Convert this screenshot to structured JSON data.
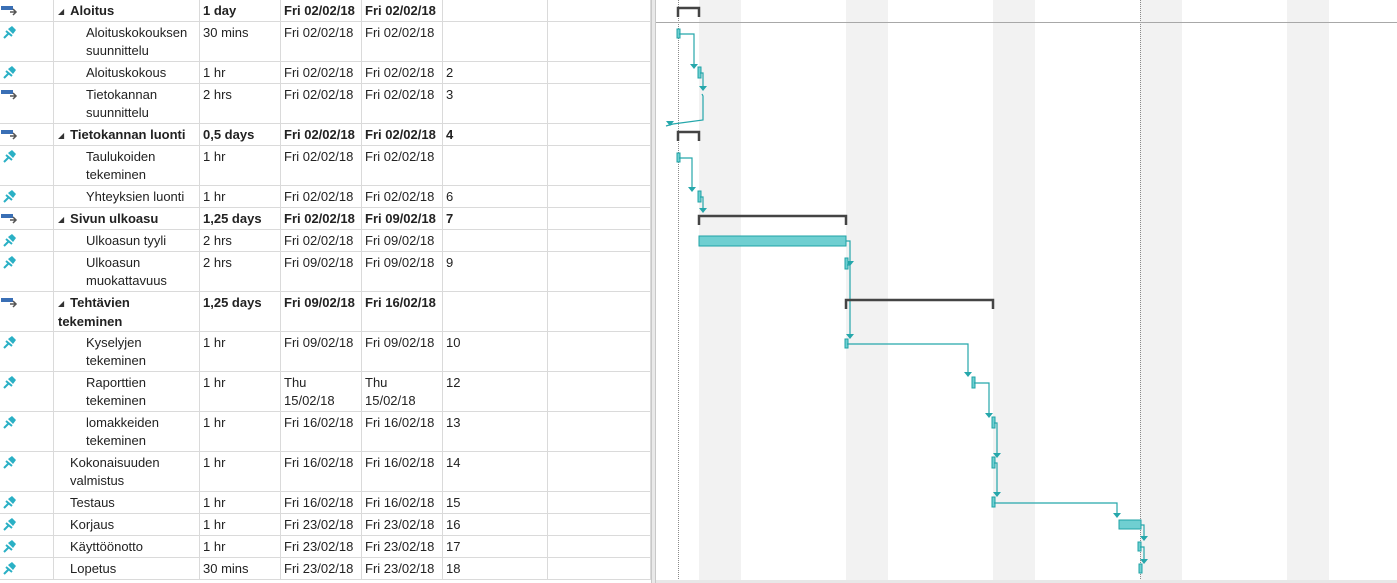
{
  "rows": [
    {
      "indicator": "arrow",
      "name": "Aloitus",
      "summary": true,
      "indent": 0,
      "duration": "1 day",
      "start": "Fri 02/02/18",
      "finish": "Fri 02/02/18",
      "pred": ""
    },
    {
      "indicator": "pin",
      "name": "Aloituskokouksen suunnittelu",
      "summary": false,
      "indent": 1,
      "duration": "30 mins",
      "start": "Fri 02/02/18",
      "finish": "Fri 02/02/18",
      "pred": ""
    },
    {
      "indicator": "pin",
      "name": "Aloituskokous",
      "summary": false,
      "indent": 1,
      "duration": "1 hr",
      "start": "Fri 02/02/18",
      "finish": "Fri 02/02/18",
      "pred": "2"
    },
    {
      "indicator": "arrow",
      "name": "Tietokannan suunnittelu",
      "summary": false,
      "indent": 1,
      "duration": "2 hrs",
      "start": "Fri 02/02/18",
      "finish": "Fri 02/02/18",
      "pred": "3"
    },
    {
      "indicator": "arrow",
      "name": "Tietokannan luonti",
      "summary": true,
      "indent": 0,
      "duration": "0,5 days",
      "start": "Fri 02/02/18",
      "finish": "Fri 02/02/18",
      "pred": "4"
    },
    {
      "indicator": "pin",
      "name": "Taulukoiden tekeminen",
      "summary": false,
      "indent": 1,
      "duration": "1 hr",
      "start": "Fri 02/02/18",
      "finish": "Fri 02/02/18",
      "pred": ""
    },
    {
      "indicator": "pin",
      "name": "Yhteyksien luonti",
      "summary": false,
      "indent": 1,
      "duration": "1 hr",
      "start": "Fri 02/02/18",
      "finish": "Fri 02/02/18",
      "pred": "6"
    },
    {
      "indicator": "arrow",
      "name": "Sivun ulkoasu",
      "summary": true,
      "indent": 0,
      "duration": "1,25 days",
      "start": "Fri 02/02/18",
      "finish": "Fri 09/02/18",
      "pred": "7"
    },
    {
      "indicator": "pin",
      "name": "Ulkoasun tyyli",
      "summary": false,
      "indent": 1,
      "duration": "2 hrs",
      "start": "Fri 02/02/18",
      "finish": "Fri 09/02/18",
      "pred": ""
    },
    {
      "indicator": "pin",
      "name": "Ulkoasun muokattavuus",
      "summary": false,
      "indent": 1,
      "duration": "2 hrs",
      "start": "Fri 09/02/18",
      "finish": "Fri 09/02/18",
      "pred": "9"
    },
    {
      "indicator": "arrow",
      "name": "Tehtävien tekeminen",
      "summary": true,
      "indent": 0,
      "duration": "1,25 days",
      "start": "Fri 09/02/18",
      "finish": "Fri 16/02/18",
      "pred": ""
    },
    {
      "indicator": "pin",
      "name": "Kyselyjen tekeminen",
      "summary": false,
      "indent": 1,
      "duration": "1 hr",
      "start": "Fri 09/02/18",
      "finish": "Fri 09/02/18",
      "pred": "10"
    },
    {
      "indicator": "pin",
      "name": "Raporttien tekeminen",
      "summary": false,
      "indent": 1,
      "duration": "1 hr",
      "start": "Thu 15/02/18",
      "finish": "Thu 15/02/18",
      "pred": "12"
    },
    {
      "indicator": "pin",
      "name": "lomakkeiden tekeminen",
      "summary": false,
      "indent": 1,
      "duration": "1 hr",
      "start": "Fri 16/02/18",
      "finish": "Fri 16/02/18",
      "pred": "13"
    },
    {
      "indicator": "pin",
      "name": "Kokonaisuuden valmistus",
      "summary": false,
      "indent": 0,
      "duration": "1 hr",
      "start": "Fri 16/02/18",
      "finish": "Fri 16/02/18",
      "pred": "14"
    },
    {
      "indicator": "pin",
      "name": "Testaus",
      "summary": false,
      "indent": 0,
      "duration": "1 hr",
      "start": "Fri 16/02/18",
      "finish": "Fri 16/02/18",
      "pred": "15"
    },
    {
      "indicator": "pin",
      "name": "Korjaus",
      "summary": false,
      "indent": 0,
      "duration": "1 hr",
      "start": "Fri 23/02/18",
      "finish": "Fri 23/02/18",
      "pred": "16"
    },
    {
      "indicator": "pin",
      "name": "Käyttöönotto",
      "summary": false,
      "indent": 0,
      "duration": "1 hr",
      "start": "Fri 23/02/18",
      "finish": "Fri 23/02/18",
      "pred": "17"
    },
    {
      "indicator": "pin",
      "name": "Lopetus",
      "summary": false,
      "indent": 0,
      "duration": "30 mins",
      "start": "Fri 23/02/18",
      "finish": "Fri 23/02/18",
      "pred": "18"
    }
  ],
  "colors": {
    "task_bar": "#6fcfd1",
    "task_edge": "#1fa3a6",
    "summary_bar": "#444444",
    "link": "#25a7ab",
    "pin_icon": "#2ab0c5",
    "arrow_icon": "#3a6fb5",
    "weekend_band": "#f2f2f2"
  }
}
